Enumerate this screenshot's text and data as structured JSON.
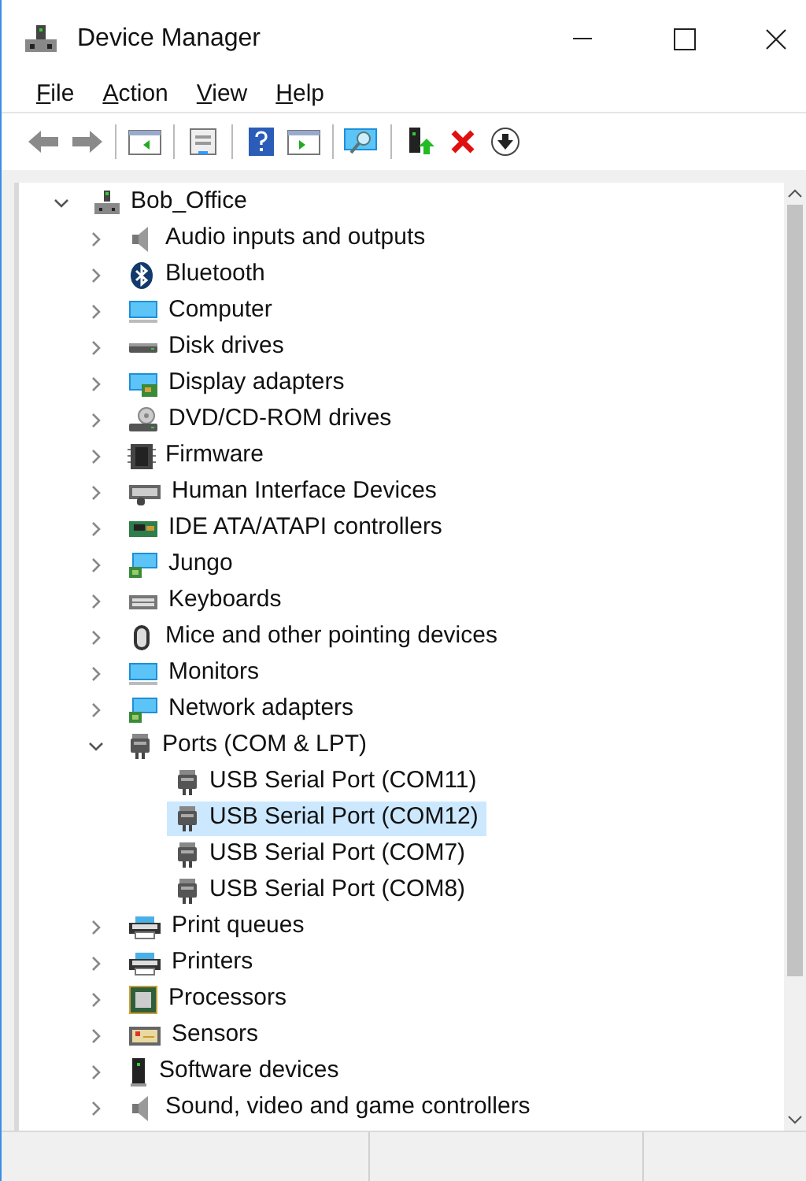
{
  "window": {
    "title": "Device Manager"
  },
  "menu": [
    "File",
    "Action",
    "View",
    "Help"
  ],
  "tree": {
    "label": "Bob_Office",
    "kind": "computer-root",
    "expanded": true,
    "children": [
      {
        "label": "Audio inputs and outputs",
        "kind": "speaker",
        "expanded": false
      },
      {
        "label": "Bluetooth",
        "kind": "bluetooth",
        "expanded": false
      },
      {
        "label": "Computer",
        "kind": "monitor",
        "expanded": false
      },
      {
        "label": "Disk drives",
        "kind": "disk",
        "expanded": false
      },
      {
        "label": "Display adapters",
        "kind": "display",
        "expanded": false
      },
      {
        "label": "DVD/CD-ROM drives",
        "kind": "dvd",
        "expanded": false
      },
      {
        "label": "Firmware",
        "kind": "chip",
        "expanded": false
      },
      {
        "label": "Human Interface Devices",
        "kind": "hid",
        "expanded": false
      },
      {
        "label": "IDE ATA/ATAPI controllers",
        "kind": "ide",
        "expanded": false
      },
      {
        "label": "Jungo",
        "kind": "network",
        "expanded": false
      },
      {
        "label": "Keyboards",
        "kind": "keyboard",
        "expanded": false
      },
      {
        "label": "Mice and other pointing devices",
        "kind": "mouse",
        "expanded": false
      },
      {
        "label": "Monitors",
        "kind": "monitor",
        "expanded": false
      },
      {
        "label": "Network adapters",
        "kind": "network",
        "expanded": false
      },
      {
        "label": "Ports (COM & LPT)",
        "kind": "port",
        "expanded": true,
        "children": [
          {
            "label": "USB Serial Port (COM11)",
            "kind": "port",
            "selected": false
          },
          {
            "label": "USB Serial Port (COM12)",
            "kind": "port",
            "selected": true
          },
          {
            "label": "USB Serial Port (COM7)",
            "kind": "port",
            "selected": false
          },
          {
            "label": "USB Serial Port (COM8)",
            "kind": "port",
            "selected": false
          }
        ]
      },
      {
        "label": "Print queues",
        "kind": "printer",
        "expanded": false
      },
      {
        "label": "Printers",
        "kind": "printer",
        "expanded": false
      },
      {
        "label": "Processors",
        "kind": "processor",
        "expanded": false
      },
      {
        "label": "Sensors",
        "kind": "sensor",
        "expanded": false
      },
      {
        "label": "Software devices",
        "kind": "software",
        "expanded": false
      },
      {
        "label": "Sound, video and game controllers",
        "kind": "speaker",
        "expanded": false
      }
    ]
  }
}
